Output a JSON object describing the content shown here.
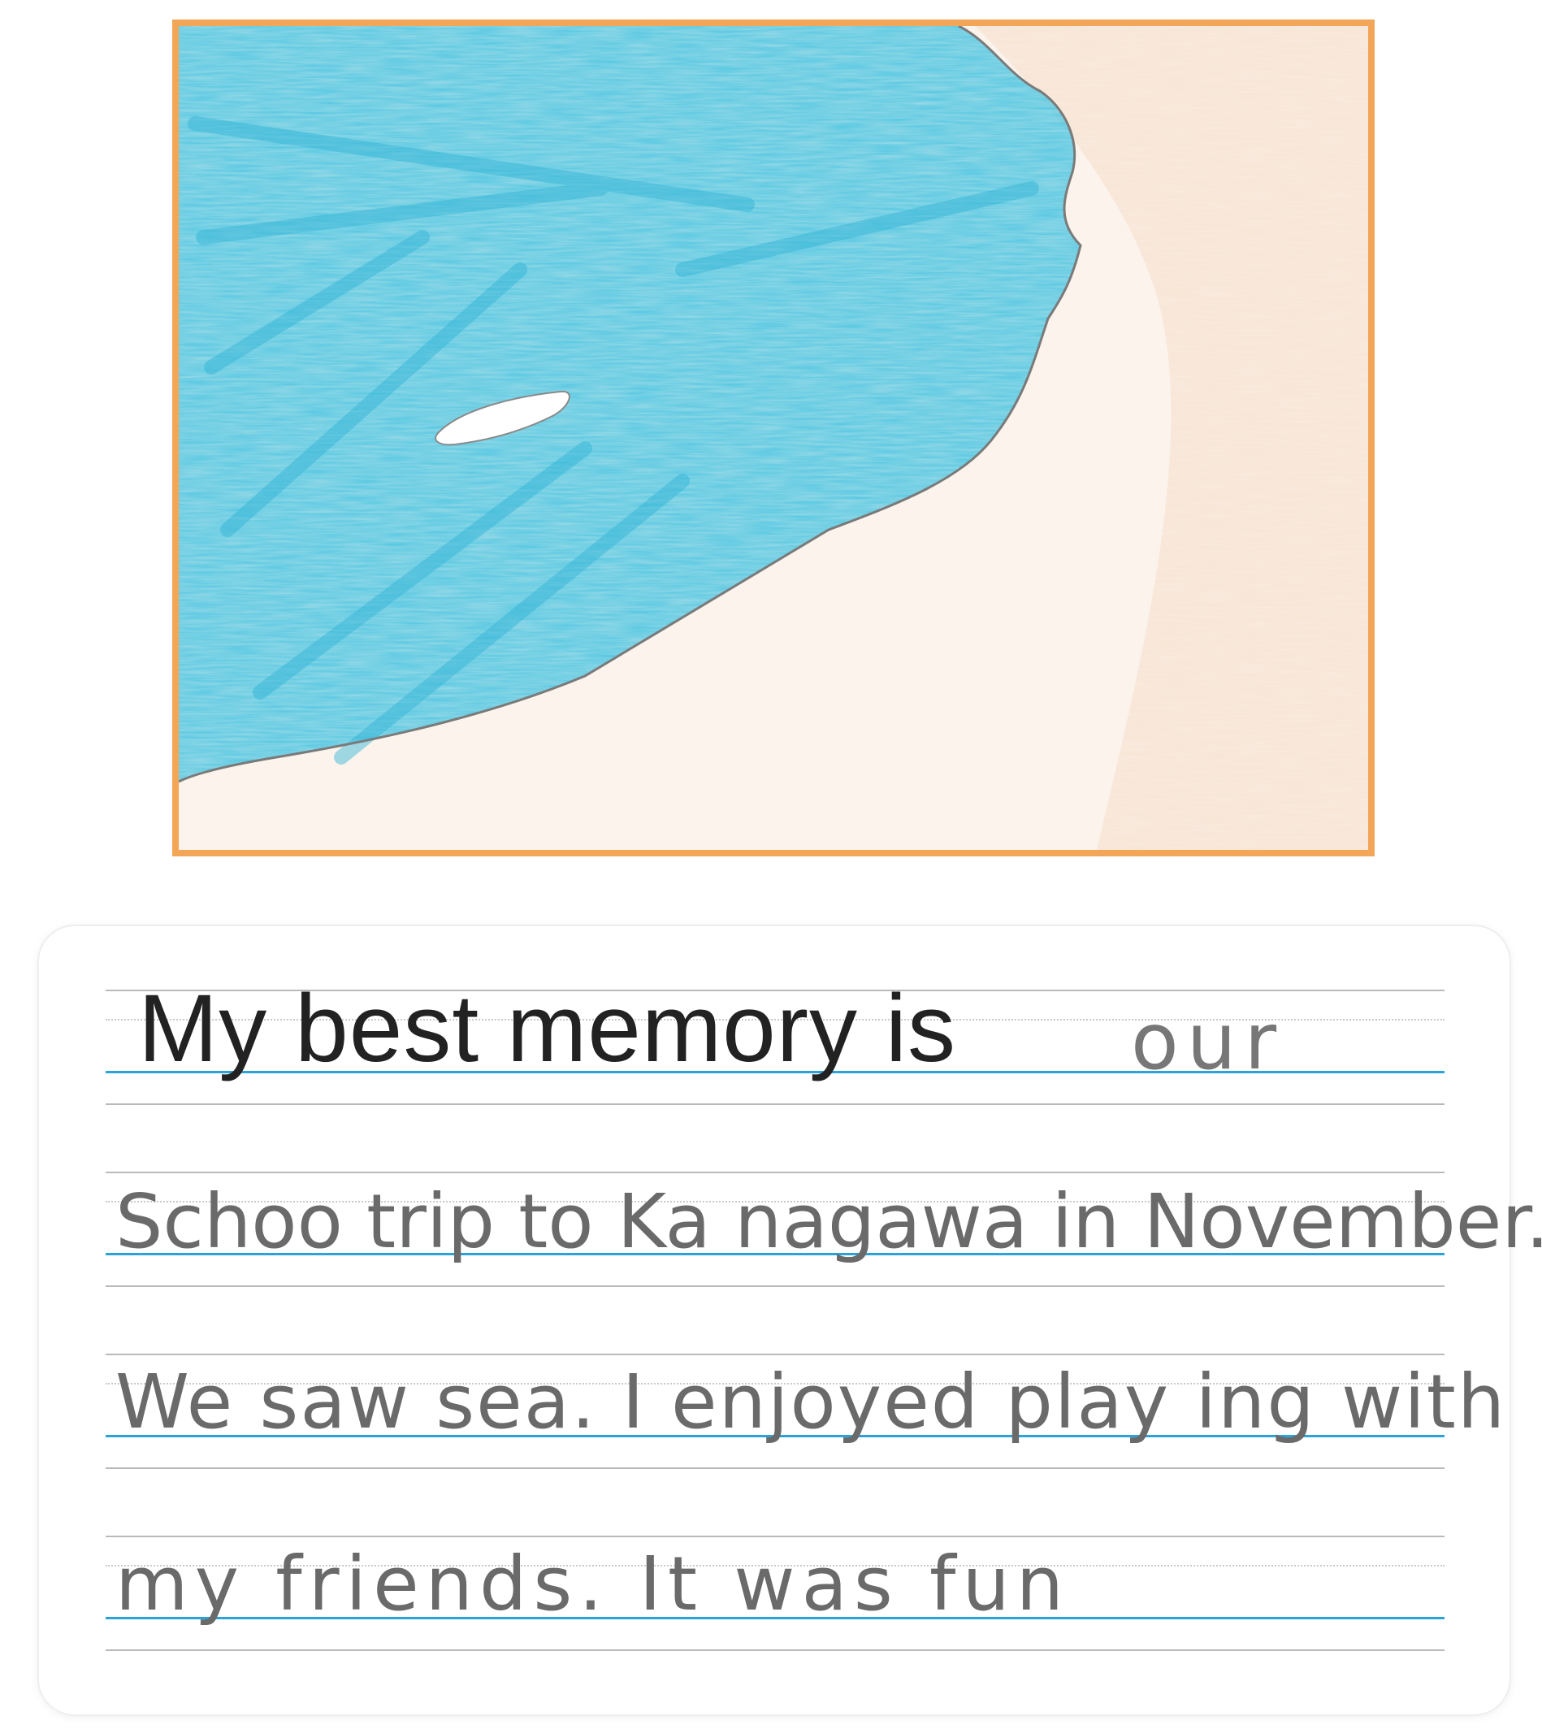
{
  "drawing": {
    "colors": {
      "frame": "#f3a657",
      "sea": "#4fc6e2",
      "sand": "#f2c9a8",
      "shoreline": "#7a7a7a"
    }
  },
  "writing": {
    "prompt": "My best memory is",
    "handwritten_lines": [
      "our",
      "Schoo trip to Ka nagawa in November.",
      "We saw sea. I enjoyed play ing with",
      "my friends. It was fun"
    ],
    "colors": {
      "baseline": "#2aa3d8",
      "rule": "#b9b9b9",
      "prompt_text": "#222222",
      "handwriting": "#6a6a6a"
    }
  }
}
